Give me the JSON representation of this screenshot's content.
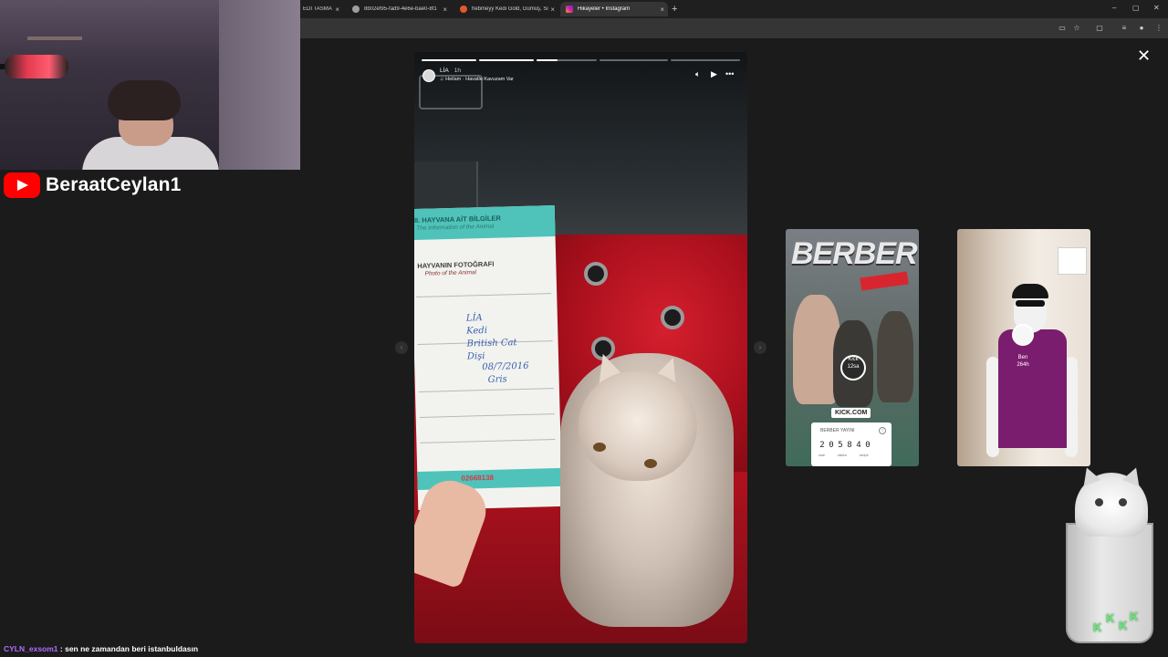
{
  "browser": {
    "tabs": [
      {
        "label": "EDİ TASMA",
        "icon_color": "#1f1f1f",
        "active": false
      },
      {
        "label": "8b02ef95-fad9-4e6e-bae0-8f1",
        "icon_color": "#9e9e9e",
        "active": false
      },
      {
        "label": "hebmeyy Kedi Gold, Gümüş, Si",
        "icon_color": "#e05a2b",
        "active": false
      },
      {
        "label": "Hikayeler • Instagram",
        "icon_color": "#d6249f",
        "active": true
      }
    ],
    "close_glyph": "×",
    "new_tab_glyph": "+",
    "window_controls": [
      "–",
      "▢",
      "✕"
    ],
    "toolbar_icons": [
      "cast-icon",
      "star-icon",
      "extensions-icon",
      "menu-icon"
    ]
  },
  "stream": {
    "channel_name": "BeraatCeylan1",
    "chat": {
      "user": "CYLN_exsom1",
      "message": ": sen ne zamandan beri istanbuldasın"
    }
  },
  "story": {
    "user": "LİA",
    "time": "1h",
    "song": "Heilam · Havatle Kavuzam Var",
    "progress": [
      1.0,
      1.0,
      0.35,
      0.0,
      0.0
    ],
    "card": {
      "title": "II. HAYVANA AİT BİLGİLER",
      "subtitle": "The Information of the Animal",
      "photo_label": "HAYVANIN FOTOĞRAFI",
      "photo_label_en": "Photo of the Animal",
      "handwriting": [
        "LİA",
        "Kedi",
        "British Cat",
        "Dişi",
        "08/7/2016",
        "Gris"
      ],
      "number": "02668138"
    }
  },
  "previews": [
    {
      "title": "BERBER",
      "badge": "KICK.COM",
      "username": "Kick",
      "time": "12sa",
      "timer_title": "BERBER YAYINI",
      "digits": [
        "2",
        "0",
        "5",
        "8",
        "4",
        "0"
      ],
      "units": [
        "saat",
        "dakika",
        "saniye"
      ]
    },
    {
      "username": "Ben",
      "time": "264h"
    }
  ],
  "sticker_text": [
    "K",
    "K",
    "K",
    "K"
  ]
}
